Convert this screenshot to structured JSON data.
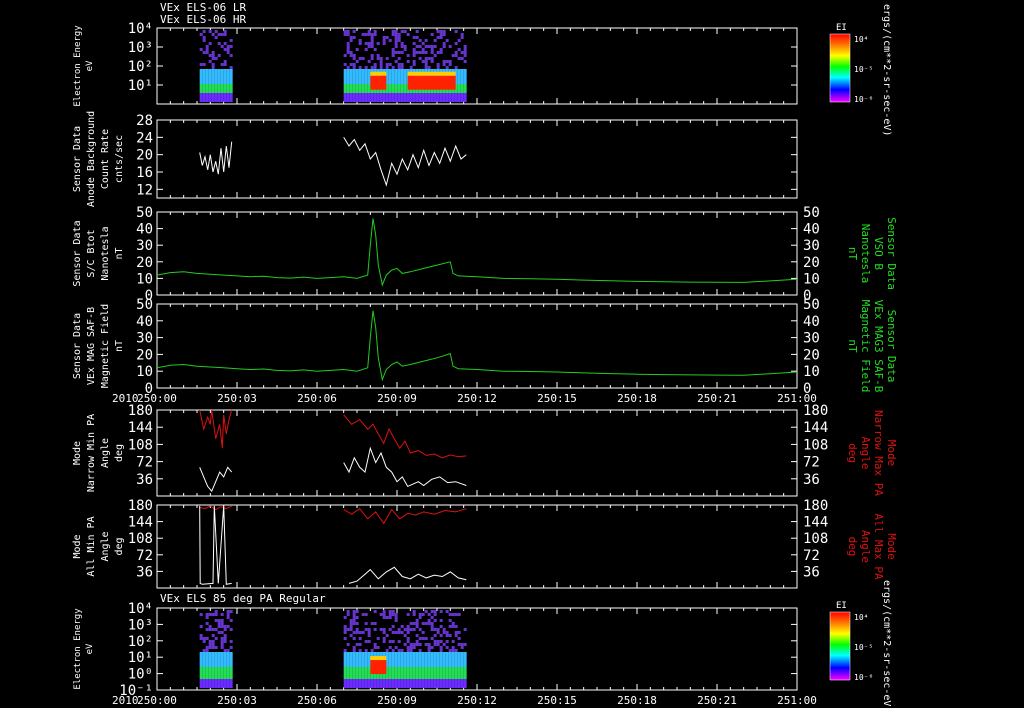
{
  "header": {
    "title_line1": "VEx ELS-06 LR",
    "title_line2": "VEx ELS-06 HR"
  },
  "colors": {
    "background": "#000000",
    "axis": "#ffffff",
    "mag": "#22cc22",
    "max_pa": "#dd1111",
    "min_pa": "#ffffff",
    "green_label": "#22dd22",
    "red_label": "#dd1111"
  },
  "time_axis": {
    "year_label": "2010",
    "tick_labels": [
      "250:00",
      "250:03",
      "250:06",
      "250:09",
      "250:12",
      "250:15",
      "250:18",
      "250:21",
      "251:00"
    ],
    "range_hours": [
      0,
      24
    ]
  },
  "colorbar": {
    "title": "EI",
    "tick_labels": [
      "10⁴",
      "10⁻⁵",
      "10⁻⁶"
    ],
    "unit_label": "ergs/(cm**2-sr-sec-eV)"
  },
  "bottom_panel_title": "VEx ELS 85 deg PA Regular",
  "chart_data": [
    {
      "id": "electron_spectrogram_top",
      "type": "heatmap",
      "ylabel": [
        "Electron Energy",
        "eV"
      ],
      "yscale": "log",
      "ylim": [
        1,
        10000
      ],
      "y_tick_labels": [
        "10⁴",
        "10³",
        "10²",
        "10¹"
      ],
      "data_intervals_hours": [
        [
          1.6,
          2.8
        ],
        [
          7.0,
          11.6
        ]
      ],
      "intense_intervals_hours": [
        [
          8.0,
          8.6
        ],
        [
          9.4,
          11.2
        ]
      ]
    },
    {
      "id": "background_count_rate",
      "type": "line",
      "ylabel": [
        "Sensor Data",
        "Anode Background",
        "Count Rate",
        "cnts/sec"
      ],
      "ylim": [
        10,
        28
      ],
      "y_tick_labels": [
        "28",
        "24",
        "20",
        "16",
        "12"
      ],
      "series": [
        {
          "x": [
            1.6,
            1.7,
            1.8,
            1.9,
            2.0,
            2.1,
            2.2,
            2.3,
            2.4,
            2.5,
            2.6,
            2.7,
            2.8
          ],
          "values": [
            20.5,
            17.5,
            19.5,
            16.5,
            20,
            16,
            18.5,
            15.5,
            21.5,
            16,
            22,
            17,
            23
          ]
        },
        {
          "x": [
            7.0,
            7.2,
            7.4,
            7.6,
            7.8,
            8.0,
            8.2,
            8.4,
            8.6,
            8.8,
            9.0,
            9.2,
            9.4,
            9.6,
            9.8,
            10.0,
            10.2,
            10.4,
            10.6,
            10.8,
            11.0,
            11.2,
            11.4,
            11.6
          ],
          "values": [
            24,
            22,
            23.5,
            21,
            22.5,
            19,
            20.5,
            16.5,
            13,
            18,
            15.5,
            19,
            16.5,
            20,
            17,
            21,
            17.5,
            20.5,
            18,
            21.5,
            18.5,
            22,
            19,
            20
          ]
        }
      ]
    },
    {
      "id": "sc_btot",
      "type": "line",
      "ylabel": [
        "Sensor Data",
        "S/C Btot",
        "Nanotesla",
        "nT"
      ],
      "right_label": [
        "Sensor Data",
        "VSO B",
        "Nanotesla",
        "nT"
      ],
      "ylim": [
        0,
        50
      ],
      "y_tick_labels": [
        "50",
        "40",
        "30",
        "20",
        "10",
        "0"
      ],
      "series": [
        {
          "name": "",
          "x": [
            0,
            0.5,
            1.0,
            1.5,
            2.0,
            2.5,
            3.0,
            3.5,
            4.0,
            4.5,
            5.0,
            5.5,
            6.0,
            6.5,
            7.0,
            7.5,
            7.9,
            8.0,
            8.1,
            8.2,
            8.3,
            8.45,
            8.6,
            8.8,
            9.0,
            9.2,
            9.5,
            10.0,
            10.5,
            11.0,
            11.1,
            11.3,
            12.0,
            13.0,
            14.0,
            15.0,
            16.0,
            17.0,
            18.0,
            19.0,
            20.0,
            21.0,
            22.0,
            23.0,
            24.0
          ],
          "values": [
            12,
            13.5,
            14,
            13,
            12.5,
            12,
            11.5,
            11,
            11.3,
            10.5,
            10.2,
            10.8,
            10,
            10.5,
            11,
            10,
            12,
            30,
            46,
            36,
            18,
            6,
            12,
            15,
            16,
            13,
            14,
            16,
            18,
            20,
            13,
            11.5,
            11,
            10,
            9.8,
            9.5,
            9,
            8.6,
            8.2,
            8,
            7.8,
            7.7,
            7.6,
            8.5,
            9.5
          ]
        }
      ]
    },
    {
      "id": "mag_field",
      "type": "line",
      "ylabel": [
        "Sensor Data",
        "VEx MAG SAF-B",
        "Magnetic Field",
        "nT"
      ],
      "right_label": [
        "Sensor Data",
        "VEx MAG3 SAF-B",
        "Magnetic Field",
        "nT"
      ],
      "ylim": [
        0,
        50
      ],
      "y_tick_labels": [
        "50",
        "40",
        "30",
        "20",
        "10",
        "0"
      ],
      "series": [
        {
          "name": "",
          "x": [
            0,
            0.5,
            1.0,
            1.5,
            2.0,
            2.5,
            3.0,
            3.5,
            4.0,
            4.5,
            5.0,
            5.5,
            6.0,
            6.5,
            7.0,
            7.5,
            7.9,
            8.0,
            8.1,
            8.2,
            8.3,
            8.45,
            8.6,
            8.8,
            9.0,
            9.2,
            9.5,
            10.0,
            10.5,
            11.0,
            11.1,
            11.3,
            12.0,
            13.0,
            14.0,
            15.0,
            16.0,
            17.0,
            18.0,
            19.0,
            20.0,
            21.0,
            22.0,
            23.0,
            24.0
          ],
          "values": [
            12,
            13.5,
            14,
            13,
            12.5,
            12,
            11.5,
            11,
            11.3,
            10.5,
            10.2,
            10.8,
            10,
            10.5,
            11,
            10,
            12,
            30,
            46,
            36,
            18,
            5,
            11,
            14,
            15.5,
            13,
            14,
            16,
            18,
            20.5,
            13,
            11.5,
            11,
            10,
            9.8,
            9.5,
            9,
            8.6,
            8.2,
            8,
            7.8,
            7.7,
            7.6,
            8.5,
            9.5
          ]
        }
      ]
    },
    {
      "id": "narrow_pa",
      "type": "line",
      "ylabel": [
        "Mode",
        "Narrow Min PA",
        "Angle",
        "deg"
      ],
      "right_label": [
        "Mode",
        "Narrow Max PA",
        "Angle",
        "deg"
      ],
      "ylim": [
        0,
        180
      ],
      "y_tick_labels": [
        "180",
        "144",
        "108",
        "72",
        "36"
      ],
      "series": [
        {
          "name": "",
          "x": [
            1.6,
            1.75,
            1.9,
            2.0,
            2.05,
            2.2,
            2.35,
            2.45,
            2.5,
            2.6,
            2.7,
            2.8,
            7.0,
            7.3,
            7.6,
            7.9,
            8.1,
            8.3,
            8.5,
            8.7,
            8.9,
            9.1,
            9.3,
            9.5,
            9.8,
            10.1,
            10.4,
            10.7,
            11.0,
            11.3,
            11.6
          ],
          "values": [
            180,
            140,
            165,
            150,
            180,
            120,
            150,
            100,
            170,
            130,
            160,
            180,
            170,
            150,
            160,
            140,
            150,
            130,
            110,
            140,
            120,
            100,
            115,
            90,
            95,
            85,
            88,
            80,
            86,
            82,
            84
          ]
        },
        {
          "name": "",
          "x": [
            1.6,
            1.75,
            1.9,
            2.05,
            2.2,
            2.35,
            2.5,
            2.65,
            2.8,
            7.0,
            7.2,
            7.4,
            7.6,
            7.8,
            8.0,
            8.2,
            8.4,
            8.6,
            8.8,
            9.0,
            9.2,
            9.4,
            9.6,
            9.8,
            10.0,
            10.3,
            10.6,
            10.9,
            11.2,
            11.6
          ],
          "values": [
            60,
            40,
            20,
            10,
            30,
            50,
            40,
            60,
            50,
            70,
            50,
            80,
            60,
            50,
            100,
            70,
            90,
            60,
            50,
            30,
            40,
            20,
            25,
            30,
            22,
            35,
            40,
            28,
            30,
            22
          ]
        }
      ]
    },
    {
      "id": "all_pa",
      "type": "line",
      "ylabel": [
        "Mode",
        "All Min PA",
        "Angle",
        "deg"
      ],
      "right_label": [
        "Mode",
        "All Max PA",
        "Angle",
        "deg"
      ],
      "ylim": [
        0,
        180
      ],
      "y_tick_labels": [
        "180",
        "144",
        "108",
        "72",
        "36"
      ],
      "series": [
        {
          "name": "",
          "x": [
            1.6,
            1.8,
            2.0,
            2.2,
            2.4,
            2.6,
            2.8,
            7.0,
            7.3,
            7.6,
            7.9,
            8.2,
            8.5,
            8.8,
            9.1,
            9.4,
            9.7,
            10.0,
            10.4,
            10.8,
            11.2,
            11.6
          ],
          "values": [
            175,
            172,
            178,
            170,
            176,
            172,
            178,
            170,
            160,
            172,
            150,
            165,
            140,
            170,
            150,
            162,
            158,
            165,
            160,
            168,
            165,
            172
          ]
        },
        {
          "name": "",
          "x": [
            1.6,
            1.62,
            1.7,
            2.1,
            2.15,
            2.3,
            2.5,
            2.6,
            2.8,
            7.2,
            7.5,
            7.8,
            8.0,
            8.3,
            8.6,
            8.9,
            9.2,
            9.5,
            9.8,
            10.1,
            10.4,
            10.7,
            11.0,
            11.3,
            11.6
          ],
          "values": [
            178,
            10,
            8,
            10,
            178,
            10,
            178,
            8,
            10,
            10,
            15,
            30,
            40,
            20,
            35,
            45,
            25,
            20,
            30,
            22,
            28,
            25,
            35,
            22,
            18
          ]
        }
      ]
    },
    {
      "id": "electron_spectrogram_bottom",
      "type": "heatmap",
      "ylabel": [
        "Electron Energy",
        "eV"
      ],
      "yscale": "log",
      "ylim": [
        0.1,
        10000
      ],
      "y_tick_labels": [
        "10⁴",
        "10³",
        "10²",
        "10¹",
        "10⁰",
        "10⁻¹"
      ],
      "data_intervals_hours": [
        [
          1.6,
          2.8
        ],
        [
          7.0,
          11.6
        ]
      ],
      "intense_intervals_hours": [
        [
          8.0,
          8.6
        ]
      ]
    }
  ]
}
